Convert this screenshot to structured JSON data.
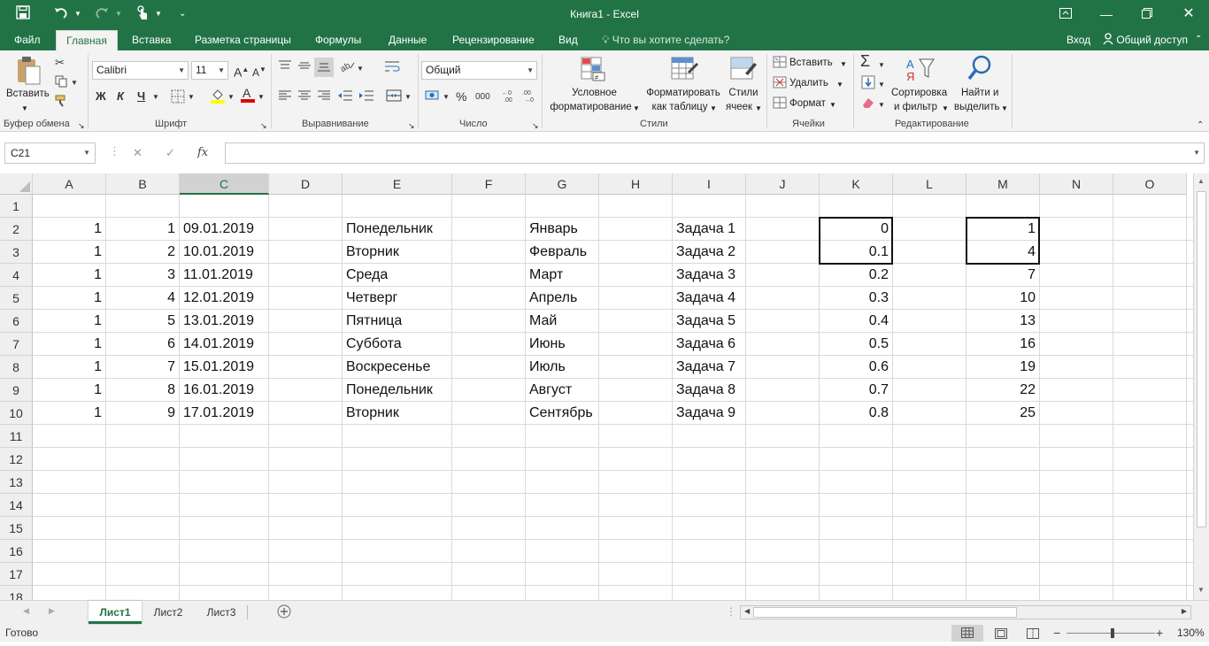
{
  "title": "Книга1 - Excel",
  "qat": {
    "save_icon": "save-icon",
    "undo_icon": "undo-icon",
    "redo_icon": "redo-icon",
    "touch_icon": "touch-mode-icon",
    "customize_icon": "customize-qat-icon"
  },
  "menu": {
    "tabs": [
      "Файл",
      "Главная",
      "Вставка",
      "Разметка страницы",
      "Формулы",
      "Данные",
      "Рецензирование",
      "Вид"
    ],
    "search_placeholder": "Что вы хотите сделать?",
    "signin": "Вход",
    "share": "Общий доступ"
  },
  "ribbon": {
    "clipboard": {
      "paste": "Вставить",
      "label": "Буфер обмена"
    },
    "font": {
      "name": "Calibri",
      "size": "11",
      "bold": "Ж",
      "italic": "К",
      "underline": "Ч",
      "label": "Шрифт"
    },
    "alignment": {
      "label": "Выравнивание"
    },
    "number": {
      "format": "Общий",
      "percent": "%",
      "thousands": "000",
      "label": "Число"
    },
    "styles": {
      "cond1": "Условное",
      "cond2": "форматирование",
      "table1": "Форматировать",
      "table2": "как таблицу",
      "cell1": "Стили",
      "cell2": "ячеек",
      "label": "Стили"
    },
    "cells": {
      "insert": "Вставить",
      "delete": "Удалить",
      "format": "Формат",
      "label": "Ячейки"
    },
    "editing": {
      "sort1": "Сортировка",
      "sort2": "и фильтр",
      "find1": "Найти и",
      "find2": "выделить",
      "label": "Редактирование"
    }
  },
  "formula_bar": {
    "name_box": "C21",
    "fx": "fx",
    "value": ""
  },
  "columns": [
    "A",
    "B",
    "C",
    "D",
    "E",
    "F",
    "G",
    "H",
    "I",
    "J",
    "K",
    "L",
    "M",
    "N",
    "O"
  ],
  "selected_column": "C",
  "rows": [
    "1",
    "2",
    "3",
    "4",
    "5",
    "6",
    "7",
    "8",
    "9",
    "10",
    "11",
    "12",
    "13",
    "14",
    "15",
    "16",
    "17",
    "18"
  ],
  "cells": {
    "A": [
      "",
      "1",
      "1",
      "1",
      "1",
      "1",
      "1",
      "1",
      "1",
      "1"
    ],
    "B": [
      "",
      "1",
      "2",
      "3",
      "4",
      "5",
      "6",
      "7",
      "8",
      "9"
    ],
    "C": [
      "",
      "09.01.2019",
      "10.01.2019",
      "11.01.2019",
      "12.01.2019",
      "13.01.2019",
      "14.01.2019",
      "15.01.2019",
      "16.01.2019",
      "17.01.2019"
    ],
    "E": [
      "",
      "Понедельник",
      "Вторник",
      "Среда",
      "Четверг",
      "Пятница",
      "Суббота",
      "Воскресенье",
      "Понедельник",
      "Вторник"
    ],
    "G": [
      "",
      "Январь",
      "Февраль",
      "Март",
      "Апрель",
      "Май",
      "Июнь",
      "Июль",
      "Август",
      "Сентябрь"
    ],
    "I": [
      "",
      "Задача 1",
      "Задача 2",
      "Задача 3",
      "Задача 4",
      "Задача 5",
      "Задача 6",
      "Задача 7",
      "Задача 8",
      "Задача 9"
    ],
    "K": [
      "",
      "0",
      "0.1",
      "0.2",
      "0.3",
      "0.4",
      "0.5",
      "0.6",
      "0.7",
      "0.8"
    ],
    "M": [
      "",
      "1",
      "4",
      "7",
      "10",
      "13",
      "16",
      "19",
      "22",
      "25"
    ]
  },
  "sheets": [
    "Лист1",
    "Лист2",
    "Лист3"
  ],
  "active_sheet": "Лист1",
  "status": {
    "ready": "Готово",
    "zoom": "130%"
  }
}
